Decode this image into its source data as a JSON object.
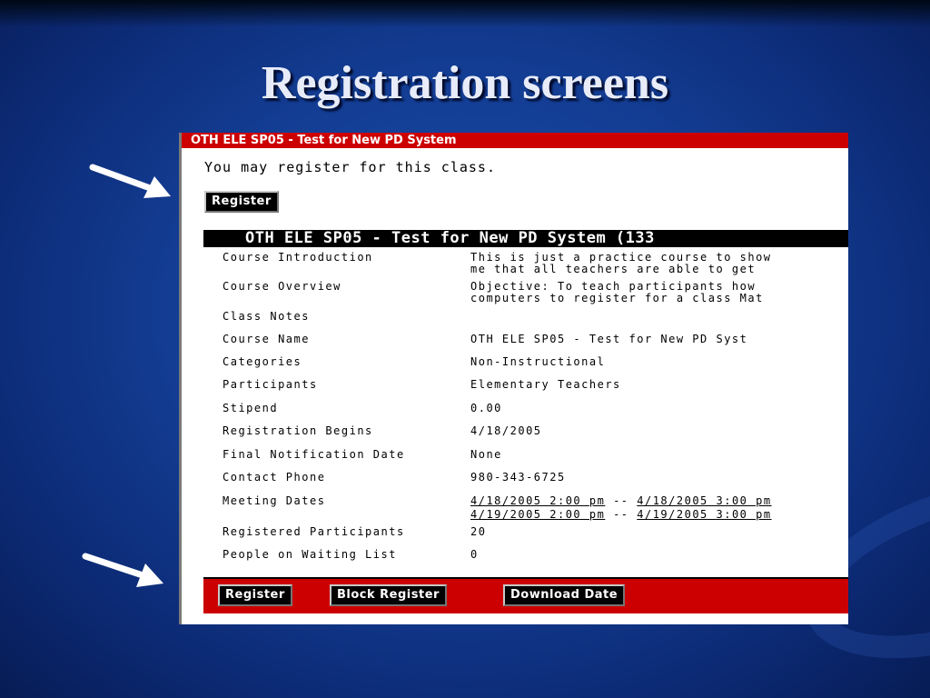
{
  "slide": {
    "title": "Registration screens"
  },
  "panel": {
    "header": "OTH ELE SP05 - Test for New PD System",
    "message": "You may register for this class.",
    "register_button": "Register",
    "course_title_bar": "OTH ELE SP05 - Test for New PD System (133",
    "rows": [
      {
        "label": "Course Introduction",
        "value": [
          "This is just a practice course to show",
          "me that all teachers are able to get"
        ]
      },
      {
        "label": "Course Overview",
        "value": [
          "Objective: To teach participants how",
          "computers to register for a class Mat"
        ]
      },
      {
        "label": "Class Notes",
        "value": []
      },
      {
        "label": "Course Name",
        "value": [
          "OTH ELE SP05 - Test for New PD Syst"
        ]
      },
      {
        "label": "Categories",
        "value": [
          "Non-Instructional"
        ]
      },
      {
        "label": "Participants",
        "value": [
          "Elementary Teachers"
        ]
      },
      {
        "label": "Stipend",
        "value": [
          "0.00"
        ]
      },
      {
        "label": "Registration Begins",
        "value": [
          "4/18/2005"
        ]
      },
      {
        "label": "Final Notification Date",
        "value": [
          "None"
        ]
      },
      {
        "label": "Contact Phone",
        "value": [
          "980-343-6725"
        ]
      },
      {
        "label": "Meeting Dates",
        "value": []
      },
      {
        "label": "Registered Participants",
        "value": [
          "20"
        ]
      },
      {
        "label": "People on Waiting List",
        "value": [
          "0"
        ]
      }
    ],
    "meeting_dates": [
      {
        "start": "4/18/2005 2:00 pm",
        "end": "4/18/2005 3:00 pm"
      },
      {
        "start": "4/19/2005 2:00 pm",
        "end": "4/19/2005 3:00 pm"
      }
    ],
    "date_separator": "--",
    "footer_buttons": {
      "register": "Register",
      "block_register": "Block Register",
      "download_date": "Download Date"
    }
  },
  "colors": {
    "header_red": "#cc0000",
    "background_blue": "#133d93",
    "arrow": "#ffffff"
  },
  "icons": [
    "arrow-right-icon"
  ]
}
